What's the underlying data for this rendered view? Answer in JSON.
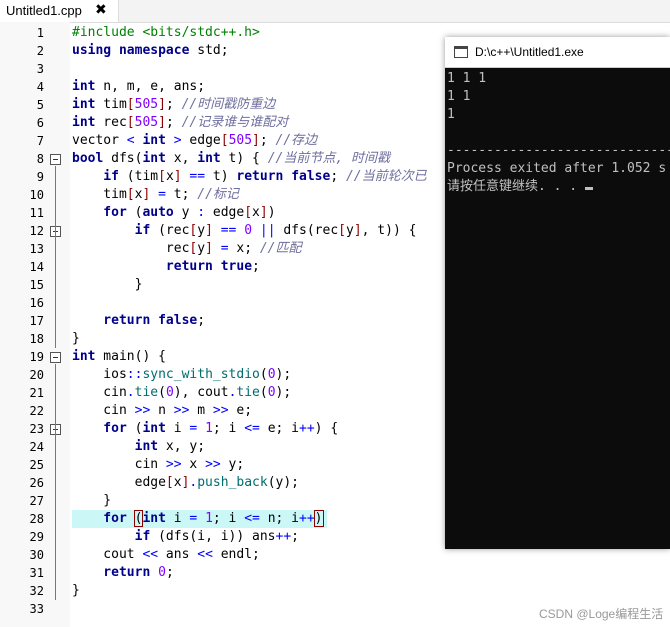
{
  "tab": {
    "filename": "Untitled1.cpp",
    "close_glyph": "✖"
  },
  "console": {
    "title": "D:\\c++\\Untitled1.exe",
    "lines": [
      "1 1 1",
      "1 1",
      "1",
      "",
      "--------------------------------",
      "Process exited after 1.052 s",
      "请按任意键继续. . . "
    ]
  },
  "watermark": "CSDN @Loge编程生活",
  "code": [
    {
      "n": "1"
    },
    {
      "n": "2"
    },
    {
      "n": "3"
    },
    {
      "n": "4"
    },
    {
      "n": "5"
    },
    {
      "n": "6"
    },
    {
      "n": "7"
    },
    {
      "n": "8"
    },
    {
      "n": "9"
    },
    {
      "n": "10"
    },
    {
      "n": "11"
    },
    {
      "n": "12"
    },
    {
      "n": "13"
    },
    {
      "n": "14"
    },
    {
      "n": "15"
    },
    {
      "n": "16"
    },
    {
      "n": "17"
    },
    {
      "n": "18"
    },
    {
      "n": "19"
    },
    {
      "n": "20"
    },
    {
      "n": "21"
    },
    {
      "n": "22"
    },
    {
      "n": "23"
    },
    {
      "n": "24"
    },
    {
      "n": "25"
    },
    {
      "n": "26"
    },
    {
      "n": "27"
    },
    {
      "n": "28"
    },
    {
      "n": "29"
    },
    {
      "n": "30"
    },
    {
      "n": "31"
    },
    {
      "n": "32"
    },
    {
      "n": "33"
    }
  ],
  "tokens": {
    "l1": "#include <bits/stdc++.h>",
    "l2a": "using",
    "l2b": " ",
    "l2c": "namespace",
    "l2d": " std;",
    "l4a": "int",
    "l4b": " n, m, e, ans;",
    "l5a": "int",
    "l5b": " tim",
    "l5c": "[",
    "l5d": "505",
    "l5e": "]",
    "l5f": "; ",
    "l5g": "//时间戳防重边",
    "l6a": "int",
    "l6b": " rec",
    "l6c": "[",
    "l6d": "505",
    "l6e": "]",
    "l6f": "; ",
    "l6g": "//记录谁与谁配对",
    "l7a": "vector ",
    "l7b": "<",
    "l7c": " ",
    "l7d": "int",
    "l7e": " ",
    "l7f": ">",
    "l7g": " edge",
    "l7h": "[",
    "l7i": "505",
    "l7j": "]",
    "l7k": "; ",
    "l7l": "//存边",
    "l8a": "bool",
    "l8b": " dfs(",
    "l8c": "int",
    "l8d": " x, ",
    "l8e": "int",
    "l8f": " t) { ",
    "l8g": "//当前节点, 时间戳",
    "l9a": "    if",
    "l9b": " (tim",
    "l9c": "[",
    "l9d": "x",
    "l9e": "]",
    "l9f": " ",
    "l9g": "==",
    "l9h": " t) ",
    "l9i": "return",
    "l9j": " ",
    "l9k": "false",
    "l9l": "; ",
    "l9m": "//当前轮次已",
    "l10a": "    tim",
    "l10b": "[",
    "l10c": "x",
    "l10d": "]",
    "l10e": " ",
    "l10f": "=",
    "l10g": " t; ",
    "l10h": "//标记",
    "l11a": "    for",
    "l11b": " (",
    "l11c": "auto",
    "l11d": " y ",
    "l11e": ":",
    "l11f": " edge",
    "l11g": "[",
    "l11h": "x",
    "l11i": "]",
    "l11j": ")",
    "l12a": "        if",
    "l12b": " (rec",
    "l12c": "[",
    "l12d": "y",
    "l12e": "]",
    "l12f": " ",
    "l12g": "==",
    "l12h": " ",
    "l12i": "0",
    "l12j": " ",
    "l12k": "||",
    "l12l": " dfs(rec",
    "l12m": "[",
    "l12n": "y",
    "l12o": "]",
    "l12p": ", t)) {",
    "l13a": "            rec",
    "l13b": "[",
    "l13c": "y",
    "l13d": "]",
    "l13e": " ",
    "l13f": "=",
    "l13g": " x; ",
    "l13h": "//匹配",
    "l14a": "            return",
    "l14b": " ",
    "l14c": "true",
    "l14d": ";",
    "l15": "        }",
    "l17a": "    return",
    "l17b": " ",
    "l17c": "false",
    "l17d": ";",
    "l18": "}",
    "l19a": "int",
    "l19b": " main() {",
    "l20a": "    ios",
    "l20b": "::",
    "l20c": "sync_with_stdio",
    "l20d": "(",
    "l20e": "0",
    "l20f": ");",
    "l21a": "    cin",
    "l21b": ".",
    "l21c": "tie",
    "l21d": "(",
    "l21e": "0",
    "l21f": "), cout",
    "l21g": ".",
    "l21h": "tie",
    "l21i": "(",
    "l21j": "0",
    "l21k": ");",
    "l22a": "    cin ",
    "l22b": ">>",
    "l22c": " n ",
    "l22d": ">>",
    "l22e": " m ",
    "l22f": ">>",
    "l22g": " e;",
    "l23a": "    for",
    "l23b": " (",
    "l23c": "int",
    "l23d": " i ",
    "l23e": "=",
    "l23f": " ",
    "l23g": "1",
    "l23h": "; i ",
    "l23i": "<=",
    "l23j": " e; i",
    "l23k": "++",
    "l23l": ") {",
    "l24a": "        int",
    "l24b": " x, y;",
    "l25a": "        cin ",
    "l25b": ">>",
    "l25c": " x ",
    "l25d": ">>",
    "l25e": " y;",
    "l26a": "        edge",
    "l26b": "[",
    "l26c": "x",
    "l26d": "]",
    "l26e": ".",
    "l26f": "push_back",
    "l26g": "(y);",
    "l27": "    }",
    "l28a": "    for",
    "l28b": " ",
    "l28c": "(",
    "l28d": "int",
    "l28e": " i ",
    "l28f": "=",
    "l28g": " ",
    "l28h": "1",
    "l28i": "; i ",
    "l28j": "<=",
    "l28k": " n; i",
    "l28l": "++",
    "l28m": ")",
    "l29a": "        if",
    "l29b": " (dfs(i, i)) ans",
    "l29c": "++",
    "l29d": ";",
    "l30a": "    cout ",
    "l30b": "<<",
    "l30c": " ans ",
    "l30d": "<<",
    "l30e": " endl;",
    "l31a": "    return",
    "l31b": " ",
    "l31c": "0",
    "l31d": ";",
    "l32": "}"
  }
}
